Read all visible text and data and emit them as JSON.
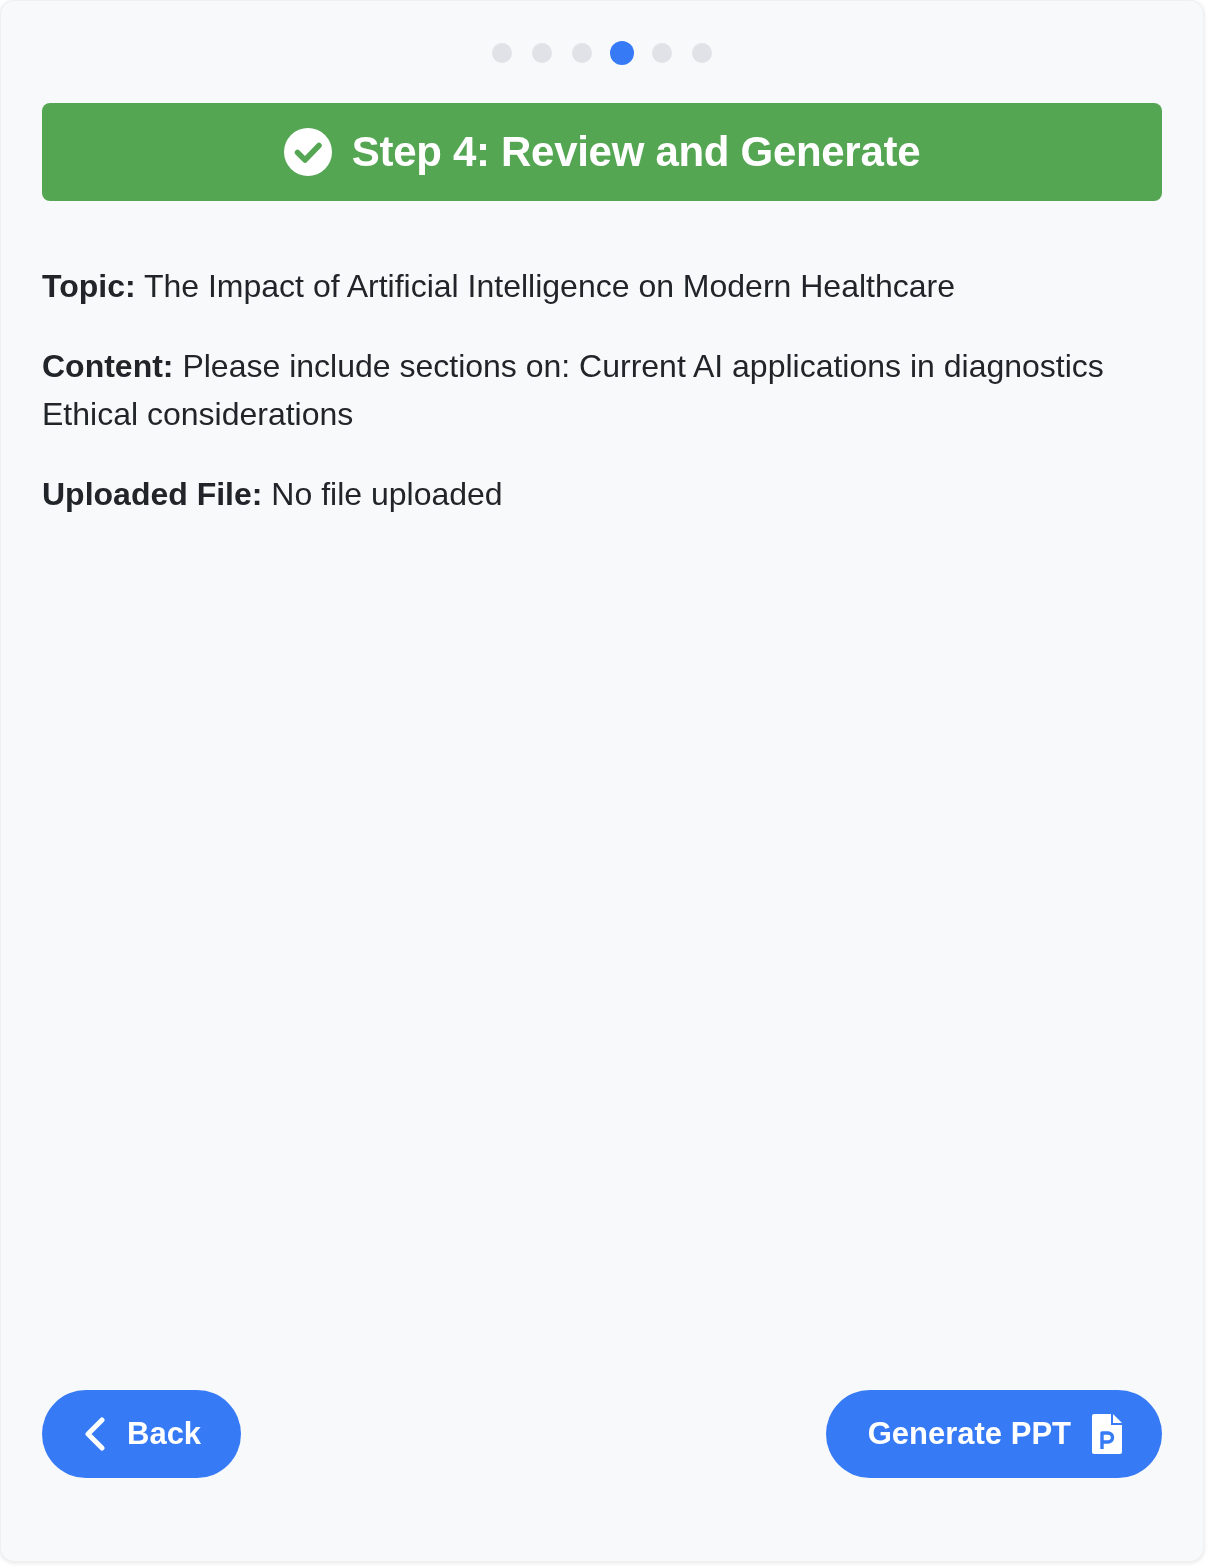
{
  "progress": {
    "steps": [
      {
        "selected": false
      },
      {
        "selected": false
      },
      {
        "selected": false
      },
      {
        "selected": true
      },
      {
        "selected": false
      },
      {
        "selected": false
      }
    ]
  },
  "header": {
    "title": "Step 4: Review and Generate"
  },
  "summary": [
    "**Topic:** The Impact of Artificial Intelligence on Modern Healthcare",
    "**Content:** Please include sections on: Current AI applications in diagnostics Ethical considerations",
    "**Uploaded File:** No file uploaded"
  ],
  "buttons": [
    {
      "kind": "back",
      "label": "Back"
    },
    {
      "kind": "generate",
      "label": "Generate PPT"
    }
  ]
}
